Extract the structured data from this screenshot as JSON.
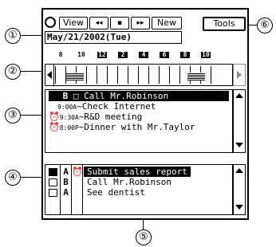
{
  "toolbar": {
    "view_label": "View",
    "prev_label": "◂◂",
    "today_label": "▪",
    "next_label": "▸▸",
    "new_label": "New",
    "tools_label": "Tools"
  },
  "date": "May/21/2002(Tue)",
  "timeline": {
    "hours": [
      "8",
      "10",
      "12",
      "2",
      "4",
      "6",
      "8",
      "10"
    ],
    "inverted": [
      false,
      false,
      true,
      true,
      true,
      true,
      true,
      true
    ]
  },
  "schedule": [
    {
      "icon": "",
      "time": "",
      "text": "Call Mr.Robinson",
      "prefix": "B",
      "checkbox": true,
      "selected": true
    },
    {
      "icon": "",
      "time": "9:00A",
      "text": "~Check Internet",
      "prefix": "",
      "checkbox": false,
      "selected": false
    },
    {
      "icon": "alarm-icon",
      "time": "9:30A",
      "text": "~R&D meeting",
      "prefix": "",
      "checkbox": false,
      "selected": false
    },
    {
      "icon": "alarm-icon",
      "time": "8:00P",
      "text": "~Dinner with Mr.Taylor",
      "prefix": "",
      "checkbox": false,
      "selected": false
    }
  ],
  "todos": [
    {
      "priority": "A",
      "alarm": "",
      "text": "Submit sales report",
      "checked": true,
      "selected": true
    },
    {
      "priority": "B",
      "alarm": "",
      "text": "Call Mr.Robinson",
      "checked": false,
      "selected": false
    },
    {
      "priority": "A",
      "alarm": "",
      "text": "See dentist",
      "checked": false,
      "selected": false
    }
  ],
  "todo_header": {
    "priority": "A",
    "alarm": "🔔"
  },
  "callouts": [
    "①",
    "②",
    "③",
    "④",
    "⑤",
    "⑥"
  ]
}
